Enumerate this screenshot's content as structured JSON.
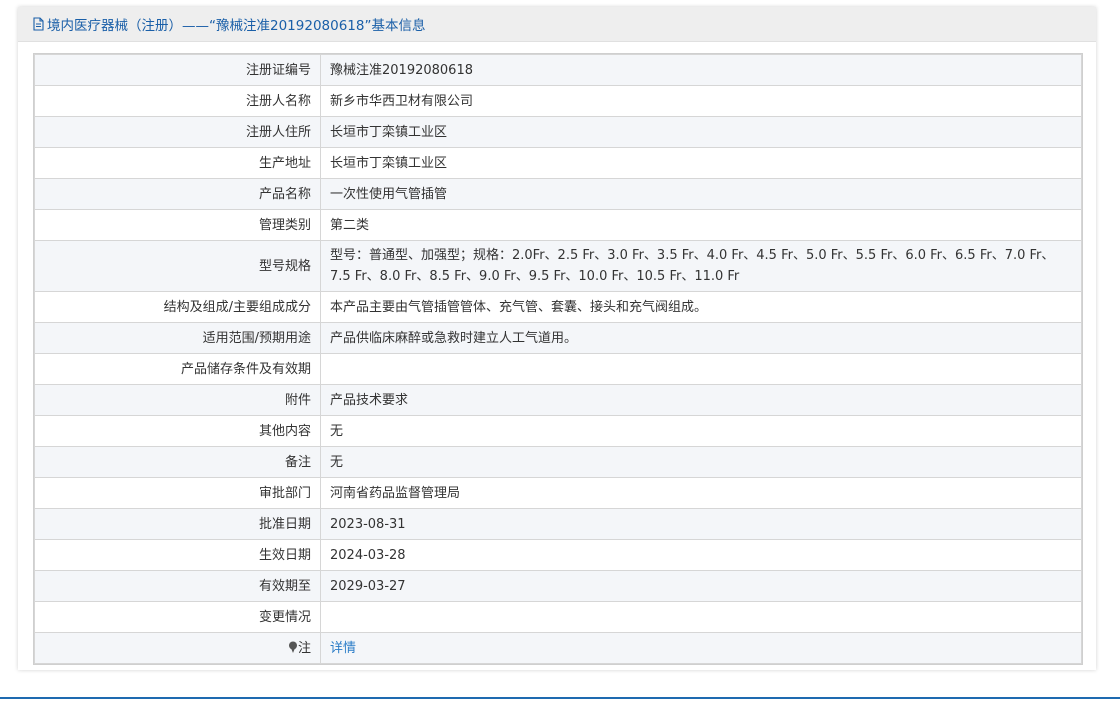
{
  "header": {
    "title": "境内医疗器械（注册）——“豫械注准20192080618”基本信息",
    "icon": "document-icon"
  },
  "colors": {
    "accent": "#1a5fa8",
    "link": "#2a7cc7",
    "alt_row": "#f4f6f9",
    "footer_line": "#1e6ab0"
  },
  "rows": [
    {
      "label": "注册证编号",
      "value": "豫械注准20192080618"
    },
    {
      "label": "注册人名称",
      "value": "新乡市华西卫材有限公司"
    },
    {
      "label": "注册人住所",
      "value": "长垣市丁栾镇工业区"
    },
    {
      "label": "生产地址",
      "value": "长垣市丁栾镇工业区"
    },
    {
      "label": "产品名称",
      "value": "一次性使用气管插管"
    },
    {
      "label": "管理类别",
      "value": "第二类"
    },
    {
      "label": "型号规格",
      "value": "型号：普通型、加强型；规格：2.0Fr、2.5 Fr、3.0 Fr、3.5 Fr、4.0 Fr、4.5 Fr、5.0 Fr、5.5 Fr、6.0 Fr、6.5 Fr、7.0 Fr、7.5 Fr、8.0 Fr、8.5 Fr、9.0 Fr、9.5 Fr、10.0 Fr、10.5 Fr、11.0 Fr"
    },
    {
      "label": "结构及组成/主要组成成分",
      "value": "本产品主要由气管插管管体、充气管、套囊、接头和充气阀组成。"
    },
    {
      "label": "适用范围/预期用途",
      "value": "产品供临床麻醉或急救时建立人工气道用。"
    },
    {
      "label": "产品储存条件及有效期",
      "value": ""
    },
    {
      "label": "附件",
      "value": "产品技术要求"
    },
    {
      "label": "其他内容",
      "value": "无"
    },
    {
      "label": "备注",
      "value": "无"
    },
    {
      "label": "审批部门",
      "value": "河南省药品监督管理局"
    },
    {
      "label": "批准日期",
      "value": "2023-08-31"
    },
    {
      "label": "生效日期",
      "value": "2024-03-28"
    },
    {
      "label": "有效期至",
      "value": "2029-03-27"
    },
    {
      "label": "变更情况",
      "value": ""
    }
  ],
  "note_row": {
    "label": "注",
    "icon": "pin-icon",
    "link_text": "详情"
  }
}
